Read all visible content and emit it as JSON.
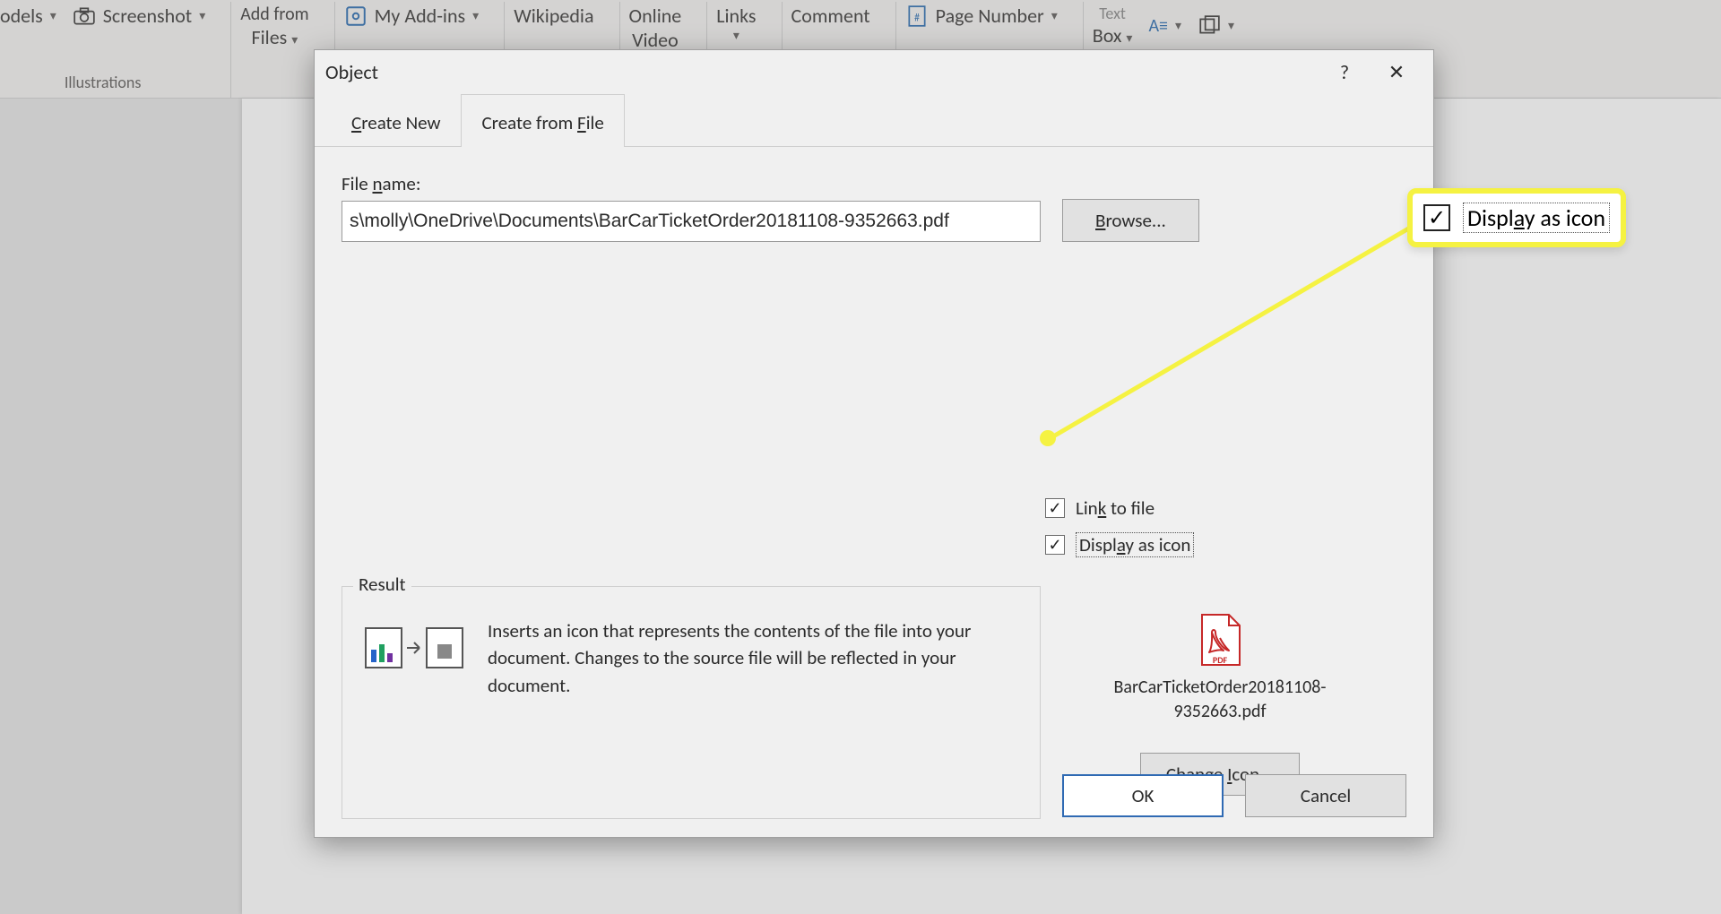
{
  "ribbon": {
    "models": "odels",
    "screenshot": "Screenshot",
    "illustrations_label": "Illustrations",
    "add_from": "Add from",
    "files": "Files",
    "my_addins": "My Add-ins",
    "wikipedia": "Wikipedia",
    "online": "Online",
    "video": "Video",
    "links": "Links",
    "comment": "Comment",
    "page_number": "Page Number",
    "box": "Box",
    "text_group": "Text"
  },
  "dialog": {
    "title": "Object",
    "tab_create_new": "Create New",
    "tab_create_from_file": "Create from File",
    "file_name_label": "File name:",
    "file_name_value": "s\\molly\\OneDrive\\Documents\\BarCarTicketOrder20181108-9352663.pdf",
    "browse": "Browse...",
    "link_to_file": "Link to file",
    "display_as_icon": "Display as icon",
    "result_legend": "Result",
    "result_text": "Inserts an icon that represents the contents of the file into your document.  Changes to the source file will be reflected in your document.",
    "preview_name": "BarCarTicketOrder20181108-9352663.pdf",
    "change_icon": "Change Icon...",
    "ok": "OK",
    "cancel": "Cancel"
  },
  "callout": {
    "label": "Display as icon"
  }
}
